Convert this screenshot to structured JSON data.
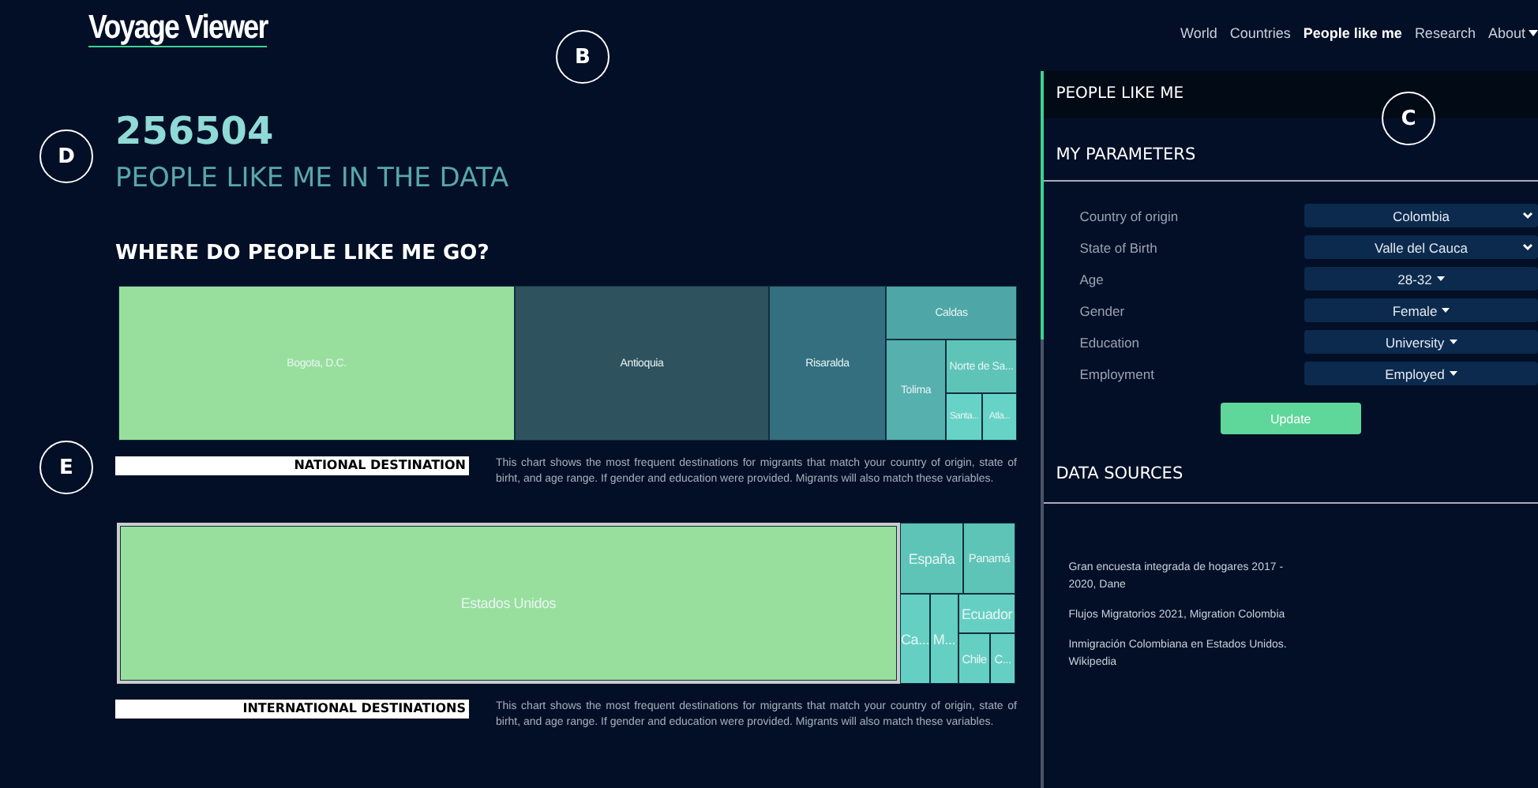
{
  "brand": "Voyage Viewer",
  "nav": [
    {
      "label": "World",
      "selected": false
    },
    {
      "label": "Countries",
      "selected": false
    },
    {
      "label": "People like me",
      "selected": true
    },
    {
      "label": "Research",
      "selected": false
    },
    {
      "label": "About",
      "selected": false,
      "kind": "dropdown"
    }
  ],
  "count": "256504",
  "count_caption": "PEOPLE LIKE ME IN THE DATA",
  "section_title": "WHERE DO PEOPLE LIKE ME GO?",
  "charts": [
    {
      "tiles": [
        {
          "label": "Bogota, D.C.",
          "color": "#98df9d"
        },
        {
          "label": "Antioquia",
          "color": "#2e525e"
        },
        {
          "label": "Risaralda",
          "color": "#336f7e"
        },
        {
          "label": "Caldas",
          "color": "#4ea6a6"
        },
        {
          "label": "Tolima",
          "color": "#55b0ae"
        },
        {
          "label": "Norte de Sa...",
          "color": "#5ec4b8"
        },
        {
          "label": "Santa...",
          "color": "#66d3c6"
        },
        {
          "label": "Atla...",
          "color": "#66d3c6"
        }
      ],
      "caption": "NATIONAL DESTINATION",
      "description": "This chart shows the most frequent destinations for migrants that match your country of origin, state of birht, and age range. If gender and education were provided. Migrants will also match these variables."
    },
    {
      "tiles": [
        {
          "label": "Estados Unidos",
          "color": "#98df9d"
        },
        {
          "label": "España",
          "color": "#5ec4b8"
        },
        {
          "label": "Panamá",
          "color": "#5ec4b8"
        },
        {
          "label": "Ca...",
          "color": "#66cfc3"
        },
        {
          "label": "M...",
          "color": "#66cfc3"
        },
        {
          "label": "Ecuador",
          "color": "#66cfc3"
        },
        {
          "label": "Chile",
          "color": "#66cfc3"
        },
        {
          "label": "C...",
          "color": "#66cfc3"
        }
      ],
      "caption": "INTERNATIONAL DESTINATIONS",
      "description": "This chart shows the most frequent destinations for migrants that match your country of origin, state of birht, and age range. If gender and education were provided. Migrants will also match these variables."
    }
  ],
  "panel": {
    "title": "PEOPLE LIKE ME",
    "parameters_title": "MY PARAMETERS",
    "parameters": [
      {
        "label": "Country of origin",
        "value": "Colombia",
        "kind": "select"
      },
      {
        "label": "State of Birth",
        "value": "Valle del Cauca",
        "kind": "select"
      },
      {
        "label": "Age",
        "value": "28-32",
        "kind": "dropdown"
      },
      {
        "label": "Gender",
        "value": "Female",
        "kind": "dropdown"
      },
      {
        "label": "Education",
        "value": "University",
        "kind": "dropdown"
      },
      {
        "label": "Employment",
        "value": "Employed",
        "kind": "dropdown"
      }
    ],
    "button": "Update",
    "sources_title": "DATA SOURCES",
    "sources": [
      "Gran encuesta integrada de hogares 2017 - 2020, Dane",
      "Flujos Migratorios 2021, Migration Colombia",
      "Inmigración Colombiana en Estados Unidos. Wikipedia"
    ]
  },
  "markers": [
    "B",
    "C",
    "D",
    "E"
  ]
}
